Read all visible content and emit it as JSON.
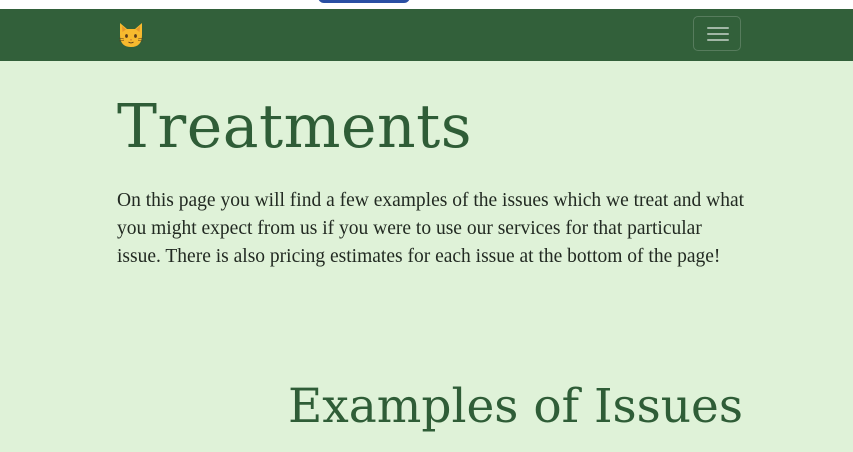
{
  "navbar": {
    "brand_icon": "cat-face-icon",
    "toggle_icon": "hamburger-menu-icon",
    "background": "#32603a"
  },
  "main": {
    "title": "Treatments",
    "intro": "On this page you will find a few examples of the issues which we treat and what you might expect from us if you were to use our services for that particular issue. There is also pricing estimates for each issue at the bottom of the page!",
    "section_title": "Examples of Issues"
  },
  "colors": {
    "page_background": "#dff2d8",
    "heading": "#2f5d37",
    "body_text": "#222a22"
  }
}
